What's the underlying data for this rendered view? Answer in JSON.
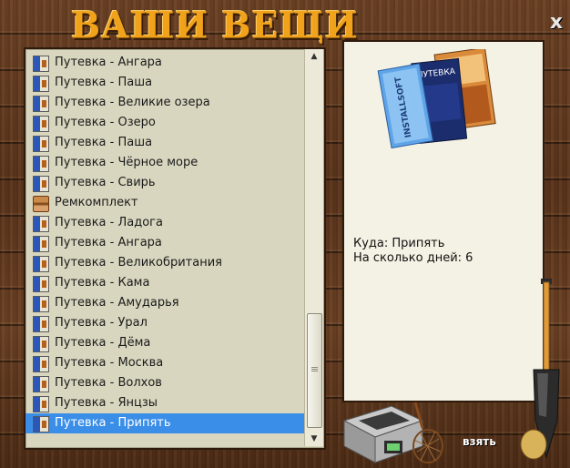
{
  "window": {
    "title": "ВАШИ ВЕЩИ",
    "close_label": "x"
  },
  "items": [
    {
      "label": "Путевка - Ангара",
      "icon": "ticket-icon"
    },
    {
      "label": "Путевка - Паша",
      "icon": "ticket-icon"
    },
    {
      "label": "Путевка - Великие озера",
      "icon": "ticket-icon"
    },
    {
      "label": "Путевка - Озеро",
      "icon": "ticket-icon"
    },
    {
      "label": "Путевка - Паша",
      "icon": "ticket-icon"
    },
    {
      "label": "Путевка - Чёрное море",
      "icon": "ticket-icon"
    },
    {
      "label": "Путевка - Свирь",
      "icon": "ticket-icon"
    },
    {
      "label": "Ремкомплект",
      "icon": "repair-kit-icon"
    },
    {
      "label": "Путевка - Ладога",
      "icon": "ticket-icon"
    },
    {
      "label": "Путевка - Ангара",
      "icon": "ticket-icon"
    },
    {
      "label": "Путевка - Великобритания",
      "icon": "ticket-icon"
    },
    {
      "label": "Путевка - Кама",
      "icon": "ticket-icon"
    },
    {
      "label": "Путевка - Амударья",
      "icon": "ticket-icon"
    },
    {
      "label": "Путевка - Урал",
      "icon": "ticket-icon"
    },
    {
      "label": "Путевка - Дёма",
      "icon": "ticket-icon"
    },
    {
      "label": "Путевка - Москва",
      "icon": "ticket-icon"
    },
    {
      "label": "Путевка - Волхов",
      "icon": "ticket-icon"
    },
    {
      "label": "Путевка - Янцзы",
      "icon": "ticket-icon"
    },
    {
      "label": "Путевка - Припять",
      "icon": "ticket-icon",
      "selected": true
    }
  ],
  "details": {
    "destination": "Куда: Припять",
    "days": "На сколько дней: 6"
  },
  "preview": {
    "brand_text": "INSTALLSOFT",
    "booklet_title": "ПУТЕВКА"
  },
  "actions": {
    "take_label": "взять"
  },
  "colors": {
    "selected": "#3a8ee8",
    "title": "#f0a21a",
    "list_bg": "#d9d6bf",
    "panel_bg": "#f4f2e4"
  }
}
